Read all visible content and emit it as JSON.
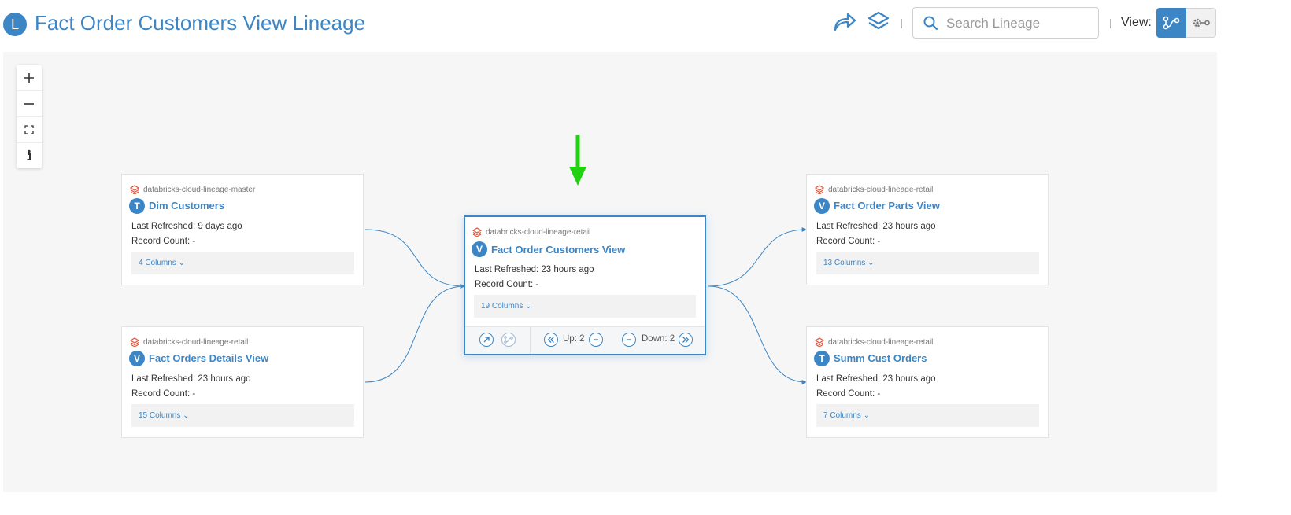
{
  "header": {
    "badge": "L",
    "title": "Fact Order Customers View Lineage",
    "search_placeholder": "Search Lineage",
    "view_label": "View:"
  },
  "colors": {
    "accent": "#3d86c6",
    "canvas_bg": "#f6f6f6",
    "source_icon": "#e0553e",
    "annotation_arrow": "#22d10f"
  },
  "icons": {
    "share": "share-arrow-icon",
    "layers": "layers-icon",
    "search": "search-icon",
    "lineage_view": "lineage-graph-icon",
    "settings_view": "gear-link-icon",
    "zoom_in": "plus-icon",
    "zoom_out": "minus-icon",
    "fit": "fit-screen-icon",
    "info": "info-icon"
  },
  "nodes": {
    "dim_customers": {
      "source": "databricks-cloud-lineage-master",
      "type": "T",
      "name": "Dim Customers",
      "last_refreshed": "Last Refreshed: 9 days ago",
      "record_count": "Record Count: -",
      "columns": "4 Columns ⌄"
    },
    "fact_orders_details": {
      "source": "databricks-cloud-lineage-retail",
      "type": "V",
      "name": "Fact Orders Details View",
      "last_refreshed": "Last Refreshed: 23 hours ago",
      "record_count": "Record Count: -",
      "columns": "15 Columns ⌄"
    },
    "fact_order_customers": {
      "source": "databricks-cloud-lineage-retail",
      "type": "V",
      "name": "Fact Order Customers View",
      "last_refreshed": "Last Refreshed: 23 hours ago",
      "record_count": "Record Count: -",
      "columns": "19 Columns ⌄",
      "up_label": "Up: 2",
      "down_label": "Down: 2"
    },
    "fact_order_parts": {
      "source": "databricks-cloud-lineage-retail",
      "type": "V",
      "name": "Fact Order Parts View",
      "last_refreshed": "Last Refreshed: 23 hours ago",
      "record_count": "Record Count: -",
      "columns": "13 Columns ⌄"
    },
    "summ_cust_orders": {
      "source": "databricks-cloud-lineage-retail",
      "type": "T",
      "name": "Summ Cust Orders",
      "last_refreshed": "Last Refreshed: 23 hours ago",
      "record_count": "Record Count: -",
      "columns": "7 Columns ⌄"
    }
  }
}
